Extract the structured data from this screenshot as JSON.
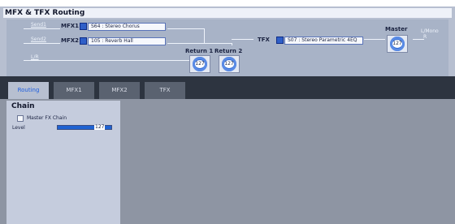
{
  "window": {
    "title": "MFX & TFX Routing"
  },
  "routing": {
    "send1_label": "Send1",
    "send2_label": "Send2",
    "lr_label": "L/R",
    "mfx1": {
      "label": "MFX1",
      "effect": "S64 : Stereo Chorus"
    },
    "mfx2": {
      "label": "MFX2",
      "effect": "105 : Reverb Hall"
    },
    "tfx": {
      "label": "TFX",
      "effect": "S07 : Stereo Parametric 4EQ"
    },
    "return1": {
      "label": "Return 1",
      "value": "127"
    },
    "return2": {
      "label": "Return 2",
      "value": "127"
    },
    "master": {
      "label": "Master",
      "value": "127"
    },
    "output_label": "L/Mono",
    "output_label_r": "R"
  },
  "tabs": [
    {
      "label": "Routing",
      "active": true
    },
    {
      "label": "MFX1",
      "active": false
    },
    {
      "label": "MFX2",
      "active": false
    },
    {
      "label": "TFX",
      "active": false
    }
  ],
  "chain": {
    "title": "Chain",
    "master_fx_chain": {
      "label": "Master FX Chain",
      "checked": false
    },
    "level": {
      "label": "Level",
      "value": "127",
      "fraction": 1.0
    }
  }
}
